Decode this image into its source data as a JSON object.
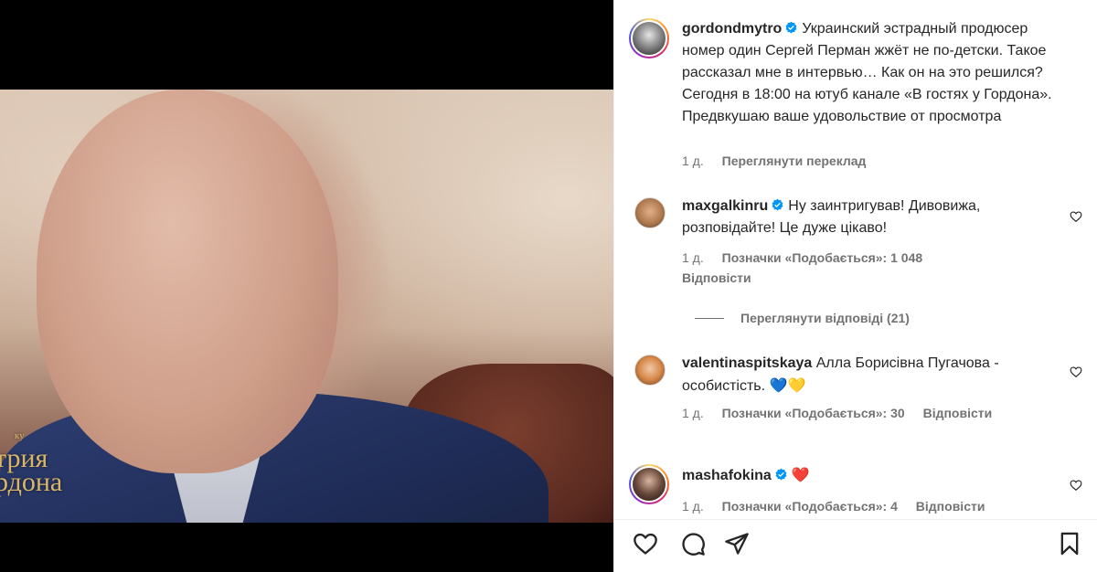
{
  "media": {
    "watermark_small": "ку",
    "watermark_line1": "трия",
    "watermark_line2": "рдона",
    "mute_icon": "speaker-muted-icon"
  },
  "caption": {
    "username": "gordondmytro",
    "text": "Украинский эстрадный продюсер номер один Сергей Перман жжёт не по-детски. Такое рассказал мне в интервью… Как он на это решился? Сегодня в 18:00 на ютуб канале «В гостях у Гордона». Предвкушаю ваше удовольствие от просмотра",
    "time": "1 д.",
    "translate": "Переглянути переклад"
  },
  "comments": [
    {
      "username": "maxgalkinru",
      "text": "Ну заинтригував! Дивовижа, розповідайте! Це дуже цікаво!",
      "time": "1 д.",
      "likes": "Позначки «Подобається»: 1 048",
      "reply": "Відповісти",
      "view_replies": "Переглянути відповіді (21)"
    },
    {
      "username": "valentinaspitskaya",
      "text": "Алла Борисівна Пугачова - особистість.",
      "emoji": "💙💛",
      "time": "1 д.",
      "likes": "Позначки «Подобається»: 30",
      "reply": "Відповісти"
    },
    {
      "username": "mashafokina",
      "text": "",
      "emoji": "❤️",
      "time": "1 д.",
      "likes": "Позначки «Подобається»: 4",
      "reply": "Відповісти"
    }
  ],
  "colors": {
    "text": "#262626",
    "secondary": "#737373",
    "verified": "#0095f6",
    "heart_red": "#ed4956",
    "blue_heart": "#1d6fe0",
    "yellow_heart": "#f5c518"
  },
  "actions": [
    "heart-icon",
    "comment-icon",
    "share-icon",
    "bookmark-icon"
  ]
}
